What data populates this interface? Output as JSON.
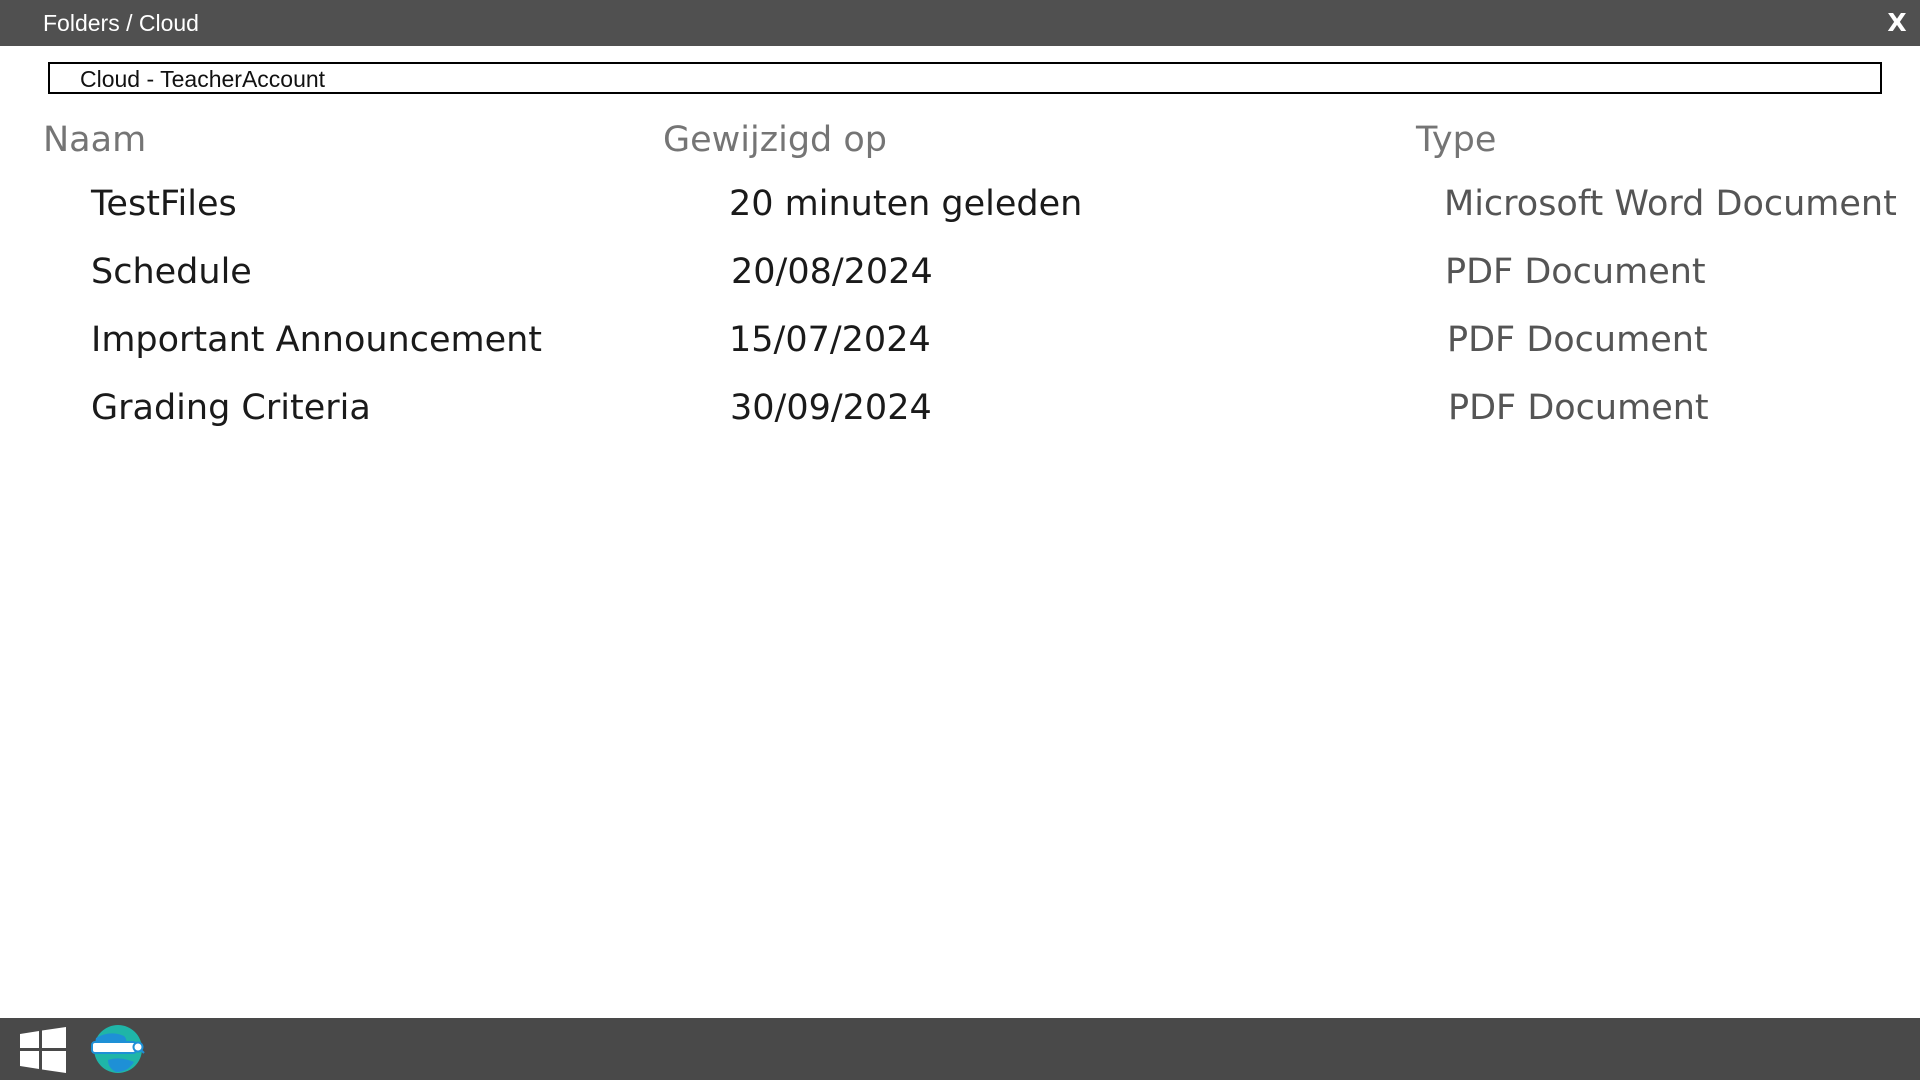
{
  "window": {
    "title": "Folders / Cloud",
    "close_label": "X"
  },
  "location": {
    "path": "Cloud - TeacherAccount"
  },
  "columns": {
    "name": "Naam",
    "modified": "Gewijzigd op",
    "type": "Type"
  },
  "files": [
    {
      "name": "TestFiles",
      "modified": "20 minuten geleden",
      "type": "Microsoft Word Document"
    },
    {
      "name": "Schedule",
      "modified": "20/08/2024",
      "type": "PDF Document"
    },
    {
      "name": "Important Announcement",
      "modified": "15/07/2024",
      "type": "PDF Document"
    },
    {
      "name": "Grading Criteria",
      "modified": "30/09/2024",
      "type": "PDF Document"
    }
  ],
  "taskbar": {
    "icons": [
      "windows-start-icon",
      "browser-search-icon"
    ]
  },
  "colors": {
    "titlebar": "#505050",
    "taskbar": "#494949",
    "header_text": "#757575",
    "type_text": "#555555",
    "browser_teal": "#1fb5a8",
    "browser_blue": "#1e90d6"
  }
}
